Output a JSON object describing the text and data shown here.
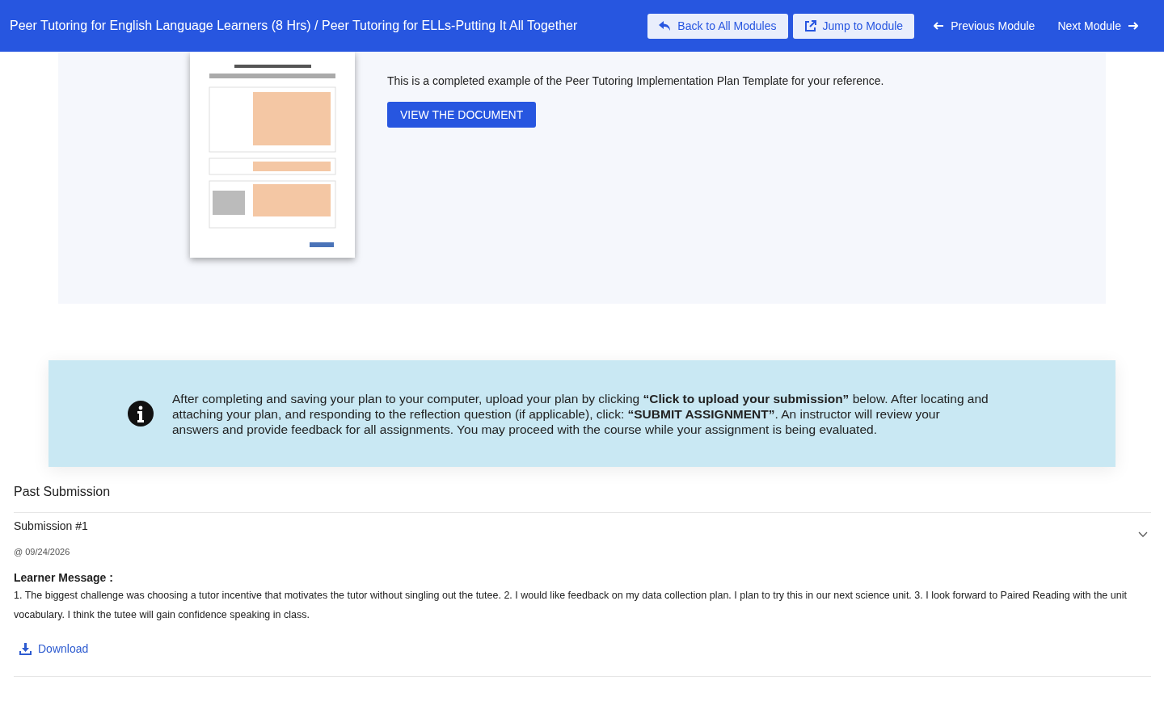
{
  "header": {
    "breadcrumb": "Peer Tutoring for English Language Learners (8 Hrs) / Peer Tutoring for ELLs-Putting It All Together",
    "buttons": [
      {
        "kind": "back",
        "label": "Back to All Modules"
      },
      {
        "kind": "jump",
        "label": "Jump to Module"
      }
    ],
    "nav": [
      {
        "kind": "previous",
        "label": "Previous Module"
      },
      {
        "kind": "next",
        "label": "Next Module"
      }
    ]
  },
  "resource": {
    "description": "This is a completed example of the Peer Tutoring Implementation Plan Template for your reference.",
    "button": "VIEW THE DOCUMENT"
  },
  "notice": {
    "text": "After completing and saving your plan to your computer, upload your plan by clicking **“Click to upload your submission”** below.  After locating and attaching your plan, and responding to the reflection question (if applicable), click: **“SUBMIT ASSIGNMENT”**.  An instructor will review your answers and provide feedback for all assignments.  You may proceed with the course while your assignment is being evaluated."
  },
  "past_submission": {
    "title": "Past Submission",
    "submissions": [
      {
        "title": "Submission #1",
        "date": "@ 09/24/2026",
        "expanded": true,
        "message_label": "Learner Message :",
        "message": "1. The biggest challenge was choosing a tutor incentive that motivates the tutor without singling out the tutee. 2. I would like feedback on my data collection plan. I plan to try this in our next science unit. 3. I look forward to Paired Reading with the unit vocabulary. I think the tutee will gain confidence speaking in class.",
        "download": "Download"
      }
    ]
  }
}
